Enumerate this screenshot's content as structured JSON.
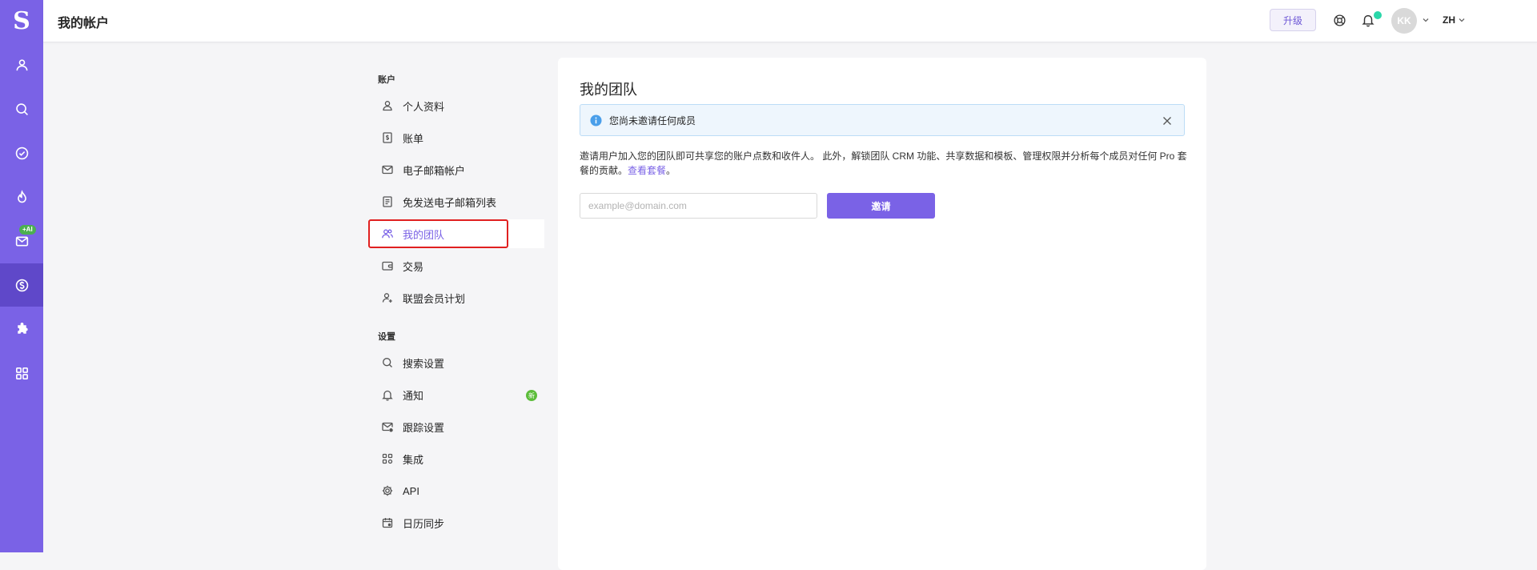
{
  "rail": {
    "logo": "S",
    "ai_badge": "+AI"
  },
  "header": {
    "title": "我的帐户",
    "upgrade_label": "升级",
    "avatar_initials": "KK",
    "language": "ZH"
  },
  "nav": {
    "account_section": "账户",
    "account_items": [
      {
        "label": "个人资料",
        "icon": "user-icon"
      },
      {
        "label": "账单",
        "icon": "invoice-icon"
      },
      {
        "label": "电子邮箱帐户",
        "icon": "mail-icon"
      },
      {
        "label": "免发送电子邮箱列表",
        "icon": "list-icon"
      },
      {
        "label": "我的团队",
        "icon": "team-icon",
        "active": true
      },
      {
        "label": "交易",
        "icon": "wallet-icon"
      },
      {
        "label": "联盟会员计划",
        "icon": "affiliate-icon"
      }
    ],
    "settings_section": "设置",
    "settings_items": [
      {
        "label": "搜索设置",
        "icon": "search-icon"
      },
      {
        "label": "通知",
        "icon": "bell-icon",
        "badge": "新"
      },
      {
        "label": "跟踪设置",
        "icon": "mail-tracking-icon"
      },
      {
        "label": "集成",
        "icon": "grid-icon"
      },
      {
        "label": "API",
        "icon": "gear-icon"
      },
      {
        "label": "日历同步",
        "icon": "calendar-icon"
      }
    ]
  },
  "main": {
    "title": "我的团队",
    "alert_text": "您尚未邀请任何成员",
    "description": "邀请用户加入您的团队即可共享您的账户点数和收件人。 此外，解锁团队 CRM 功能、共享数据和模板、管理权限并分析每个成员对任何 Pro 套餐的贡献。",
    "plans_link": "查看套餐",
    "period": "。",
    "email_placeholder": "example@domain.com",
    "invite_label": "邀请"
  },
  "colors": {
    "brand": "#7a62e6",
    "rail_active": "#5f48c9",
    "highlight": "#e02020"
  }
}
